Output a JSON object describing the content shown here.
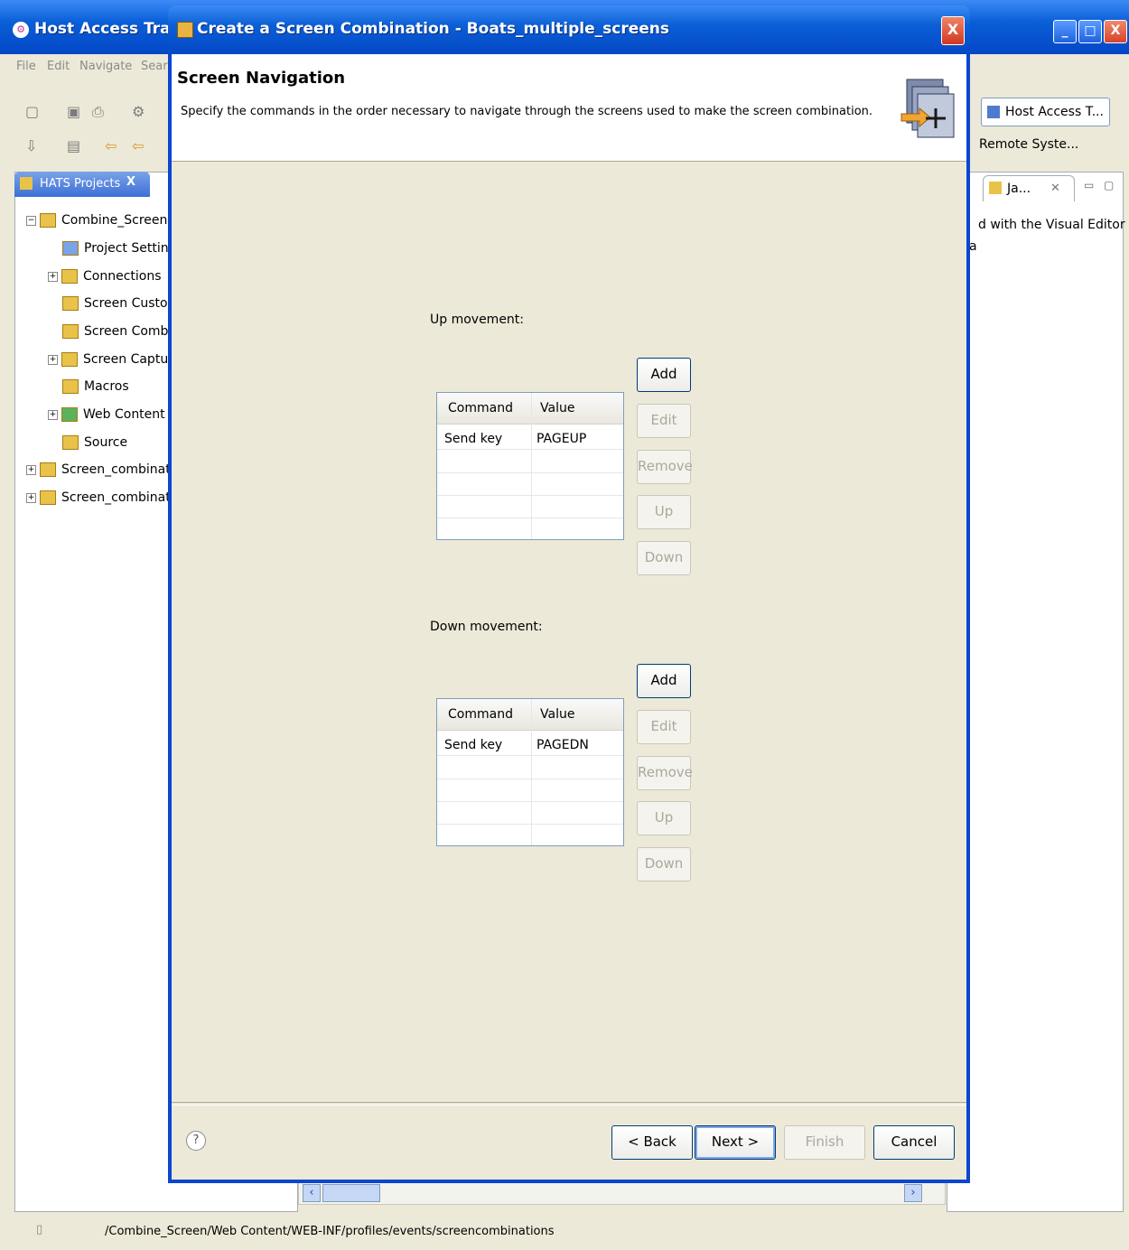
{
  "window": {
    "title": "Host Access Transfo",
    "minimize": "_",
    "maximize": "□",
    "close": "X"
  },
  "menu": [
    "File",
    "Edit",
    "Navigate",
    "Searc"
  ],
  "left_panel": {
    "tab_label": "HATS Projects",
    "tab_close": "X",
    "tree": [
      {
        "label": "Combine_Screen",
        "expander": "−"
      },
      {
        "label": "Project Settings",
        "expander": ""
      },
      {
        "label": "Connections",
        "expander": "+"
      },
      {
        "label": "Screen Customi",
        "expander": ""
      },
      {
        "label": "Screen Combina",
        "expander": ""
      },
      {
        "label": "Screen Capture",
        "expander": "+"
      },
      {
        "label": "Macros",
        "expander": ""
      },
      {
        "label": "Web Content",
        "expander": "+"
      },
      {
        "label": "Source",
        "expander": ""
      },
      {
        "label": "Screen_combination",
        "expander": "+"
      },
      {
        "label": "Screen_combination",
        "expander": "+"
      }
    ]
  },
  "right_panel": {
    "host_access_button": "Host Access T...",
    "remote_system": "Remote Syste...",
    "tab_label": "Ja...",
    "tab_close": "✕",
    "content_text": "d with the Visual Editor for",
    "content_text2": "a"
  },
  "status_bar": {
    "path": "/Combine_Screen/Web Content/WEB-INF/profiles/events/screencombinations"
  },
  "dialog": {
    "title": "Create a Screen Combination - Boats_multiple_screens",
    "close": "X",
    "heading": "Screen Navigation",
    "description": "Specify the commands in the order necessary to navigate through the screens used to make the screen combination.",
    "up": {
      "label": "Up movement:",
      "columns": [
        "Command",
        "Value"
      ],
      "rows": [
        [
          "Send key",
          "PAGEUP"
        ]
      ]
    },
    "down": {
      "label": "Down movement:",
      "columns": [
        "Command",
        "Value"
      ],
      "rows": [
        [
          "Send key",
          "PAGEDN"
        ]
      ]
    },
    "side_buttons": {
      "add": "Add",
      "edit": "Edit",
      "remove": "Remove",
      "up": "Up",
      "down": "Down"
    },
    "footer": {
      "help": "?",
      "back": "< Back",
      "next": "Next >",
      "finish": "Finish",
      "cancel": "Cancel"
    }
  }
}
